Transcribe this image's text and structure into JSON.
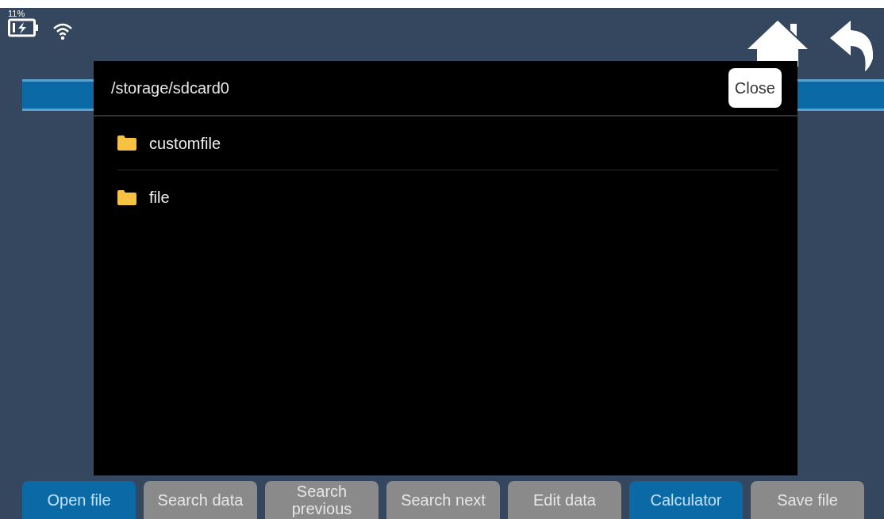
{
  "status": {
    "battery_percent": "11%"
  },
  "dialog": {
    "path": "/storage/sdcard0",
    "close_label": "Close",
    "items": [
      {
        "name": "customfile"
      },
      {
        "name": "file"
      }
    ]
  },
  "buttons": [
    {
      "label": "Open file",
      "selected": true
    },
    {
      "label": "Search data",
      "selected": false
    },
    {
      "label": "Search previous",
      "selected": false
    },
    {
      "label": "Search next",
      "selected": false
    },
    {
      "label": "Edit data",
      "selected": false
    },
    {
      "label": "Calculator",
      "selected": true
    },
    {
      "label": "Save file",
      "selected": false
    }
  ]
}
